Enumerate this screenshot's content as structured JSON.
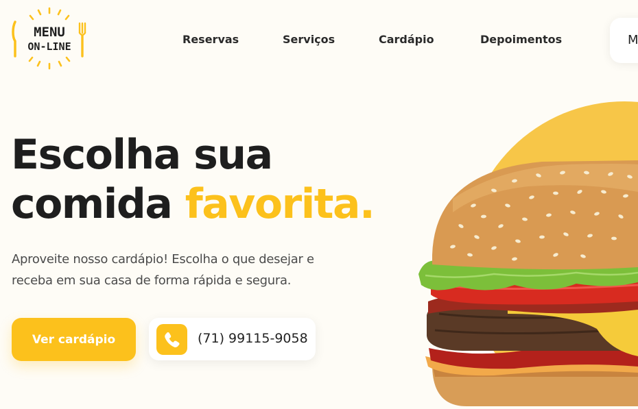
{
  "brand": {
    "logo_line1": "MENU",
    "logo_line2": "ON-LINE"
  },
  "nav": {
    "items": [
      {
        "label": "Reservas"
      },
      {
        "label": "Serviços"
      },
      {
        "label": "Cardápio"
      },
      {
        "label": "Depoimentos"
      }
    ],
    "cta_label": "M"
  },
  "hero": {
    "title_line1": "Escolha sua",
    "title_line2": "comida",
    "title_accent": "favorita.",
    "subtitle": "Aproveite nosso cardápio! Escolha o que desejar e receba em sua casa de forma rápida e segura.",
    "primary_button": "Ver cardápio",
    "phone": "(71) 99115-9058",
    "image": "hamburger-image"
  },
  "colors": {
    "accent": "#fcc11c",
    "background": "#fefcf6",
    "text": "#1e1e1e"
  },
  "icons": [
    "fork-icon",
    "phone-icon"
  ]
}
